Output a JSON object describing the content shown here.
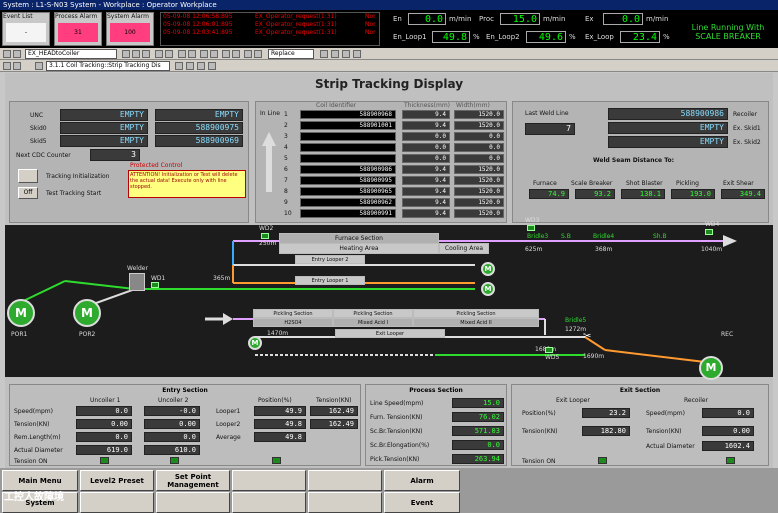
{
  "window": {
    "title": "System : L1-S-N03 System - Workplace : Operator Workplace"
  },
  "alarms": {
    "event_list": {
      "label": "Event List",
      "value": "-"
    },
    "process_alarm": {
      "label": "Process Alarm",
      "value": "31"
    },
    "system_alarm": {
      "label": "System Alarm",
      "value": "100"
    },
    "messages": [
      {
        "time": "05-09-08 12:06:58:895",
        "text": "EX_Operator_request(1:31)",
        "ack": "Nor"
      },
      {
        "time": "05-09-08 12:06:01:895",
        "text": "EX_Operator_request(1:31)",
        "ack": "Nor"
      },
      {
        "time": "05-09-08 12:03:41:895",
        "text": "EX_Operator_request(1:31)",
        "ack": "Nor"
      }
    ]
  },
  "top_values": {
    "en": {
      "label": "En",
      "value": "0.0",
      "unit": "m/min"
    },
    "proc": {
      "label": "Proc",
      "value": "15.0",
      "unit": "m/min"
    },
    "ex": {
      "label": "Ex",
      "value": "0.0",
      "unit": "m/min"
    },
    "en_loop1": {
      "label": "En_Loop1",
      "value": "49.8",
      "unit": "%"
    },
    "en_loop2": {
      "label": "En_Loop2",
      "value": "49.6",
      "unit": "%"
    },
    "ex_loop": {
      "label": "Ex_Loop",
      "value": "23.4",
      "unit": "%"
    }
  },
  "status_banner": "Line Running With SCALE BREAKER",
  "toolbar": {
    "view_select": "EX_HEADtoCoiler",
    "replace_select": "Replace",
    "nav_select": "3.1.1 Coil Tracking::Strip Tracking Dis"
  },
  "screen_title": "Strip Tracking Display",
  "left_panel": {
    "unc_label": "UNC",
    "skid0_label": "Skid0",
    "skid5_label": "Skid5",
    "unc_a": "EMPTY",
    "unc_b": "EMPTY",
    "skid0_a": "EMPTY",
    "skid0_b": "588900975",
    "skid5_a": "EMPTY",
    "skid5_b": "588900969",
    "next_cdc_label": "Next CDC Counter",
    "next_cdc": "3",
    "tracking_init": "Tracking Initialization",
    "test_tracking": "Test Tracking Start",
    "off_label": "Off",
    "protected_control": "Protected Control",
    "attention": "ATTENTION! Initialization or Test will delete the actual data! Execute only with line stopped."
  },
  "tracking_table": {
    "in_line_label": "In Line",
    "headers": [
      "Coil Identifier",
      "Thickness(mm)",
      "Width(mm)"
    ],
    "rows": [
      {
        "n": "1",
        "id": "588900968",
        "th": "9.4",
        "w": "1520.0"
      },
      {
        "n": "2",
        "id": "588901001",
        "th": "9.4",
        "w": "1520.0"
      },
      {
        "n": "3",
        "id": "",
        "th": "0.0",
        "w": "0.0"
      },
      {
        "n": "4",
        "id": "",
        "th": "0.0",
        "w": "0.0"
      },
      {
        "n": "5",
        "id": "",
        "th": "0.0",
        "w": "0.0"
      },
      {
        "n": "6",
        "id": "588900986",
        "th": "9.4",
        "w": "1520.0"
      },
      {
        "n": "7",
        "id": "588900995",
        "th": "9.4",
        "w": "1520.0"
      },
      {
        "n": "8",
        "id": "588900965",
        "th": "9.4",
        "w": "1520.0"
      },
      {
        "n": "9",
        "id": "588900962",
        "th": "9.4",
        "w": "1520.0"
      },
      {
        "n": "10",
        "id": "588900991",
        "th": "9.4",
        "w": "1520.0"
      }
    ]
  },
  "right_panel": {
    "last_weld_label": "Last Weld Line",
    "last_weld": "7",
    "recoiler_label": "Recoiler",
    "recoiler": "588900986",
    "ex_skid1_label": "Ex. Skid1",
    "ex_skid1": "EMPTY",
    "ex_skid2_label": "Ex. Skid2",
    "ex_skid2": "EMPTY",
    "weld_seam_label": "Weld Seam Distance To:",
    "distances": [
      {
        "label": "Furnace",
        "value": "74.9"
      },
      {
        "label": "Scale Breaker",
        "value": "93.2"
      },
      {
        "label": "Shot Blaster",
        "value": "138.1"
      },
      {
        "label": "Pickling",
        "value": "193.0"
      },
      {
        "label": "Exit Shear",
        "value": "349.4"
      }
    ]
  },
  "process": {
    "wd2": "WD2",
    "d250": "250m",
    "furnace": "Furnace Section",
    "heating": "Heating Area",
    "cooling": "Cooling Area",
    "wd3": "WD3",
    "bridle3": "Bridle3",
    "bridle4": "Bridle4",
    "sb": "S.B",
    "shb": "Sh.B",
    "wd4": "WD4",
    "d625": "625m",
    "d368": "368m",
    "d1040": "1040m",
    "entry_looper2": "Entry Looper 2",
    "entry_looper1": "Entry Looper 1",
    "d365": "365m",
    "welder": "Welder",
    "wd1": "WD1",
    "pickling1": "Pickling Section",
    "pickling2": "Pickling Section",
    "pickling3": "Pickling Section",
    "h2so4": "H2SO4",
    "mixed1": "Mixed Acid I",
    "mixed2": "Mixed Acid II",
    "bridle5": "Bridle5",
    "d1272": "1272m",
    "d1470": "1470m",
    "exit_looper": "Exit Looper",
    "d1680": "1680m",
    "d1690": "1690m",
    "wd5": "WD5",
    "rec": "REC",
    "por1": "POR1",
    "por2": "POR2",
    "m": "M"
  },
  "entry_section": {
    "title": "Entry Section",
    "uncoiler1": "Uncoiler 1",
    "uncoiler2": "Uncoiler 2",
    "speed_label": "Speed(mpm)",
    "tension_label": "Tension(KN)",
    "rem_length_label": "Rem.Length(m)",
    "diam_label": "Actual Diameter",
    "tension_on_label": "Tension ON",
    "u1": {
      "speed": "0.0",
      "tension": "0.00",
      "rem": "0.0",
      "diam": "619.0"
    },
    "u2": {
      "speed": "-0.0",
      "tension": "0.00",
      "rem": "0.0",
      "diam": "610.0"
    },
    "position_label": "Position(%)",
    "tension_kn_label": "Tension(KN)",
    "looper1_label": "Looper1",
    "looper2_label": "Looper2",
    "average_label": "Average",
    "l1_pos": "49.9",
    "l1_ten": "162.49",
    "l2_pos": "49.8",
    "l2_ten": "162.49",
    "avg_pos": "49.8"
  },
  "process_section": {
    "title": "Process Section",
    "rows": [
      {
        "label": "Line Speed(mpm)",
        "value": "15.0"
      },
      {
        "label": "Furn. Tension(KN)",
        "value": "76.02"
      },
      {
        "label": "Sc.Br.Tension(KN)",
        "value": "571.03"
      },
      {
        "label": "Sc.Br.Elongation(%)",
        "value": "0.0"
      },
      {
        "label": "Pick.Tension(KN)",
        "value": "263.94"
      }
    ]
  },
  "exit_section": {
    "title": "Exit Section",
    "exit_looper": "Exit Looper",
    "recoiler": "Recoiler",
    "position_label": "Position(%)",
    "pos": "23.2",
    "tension_label": "Tension(KN)",
    "tension": "182.80",
    "speed_label": "Speed(mpm)",
    "rec_speed": "0.0",
    "rec_tension_label": "Tension(KN)",
    "rec_tension": "0.00",
    "diam_label": "Actual Diameter",
    "rec_diam": "1602.4",
    "tension_on_label": "Tension ON"
  },
  "footer": {
    "main_menu": "Main Menu",
    "level2": "Level2 Preset",
    "set_point": "Set Point Management",
    "alarm": "Alarm",
    "event": "Event",
    "system": "System"
  },
  "watermark": "工控人故障境",
  "colors": {
    "lcd_green": "#00ff00",
    "alarm_pink": "#ff3d7f",
    "process_bg": "#1c1c1c",
    "banner_green": "#2fdc2f"
  }
}
